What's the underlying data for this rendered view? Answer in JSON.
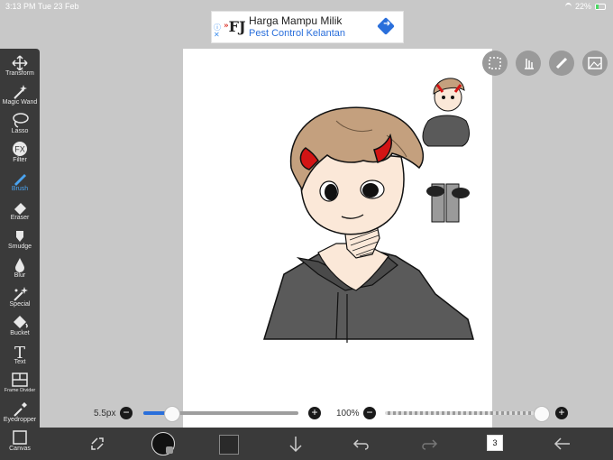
{
  "status_bar": {
    "time_date": "3:13 PM   Tue 23 Feb",
    "battery": "22%"
  },
  "ad": {
    "title": "Harga Mampu Milik",
    "subtitle": "Pest Control Kelantan",
    "logo": "FJ",
    "info_icon": "info-icon",
    "close_icon": "close-icon",
    "action_icon": "directions-icon"
  },
  "tools": [
    {
      "label": "Transform",
      "icon": "transform-icon"
    },
    {
      "label": "Magic Wand",
      "icon": "magic-wand-icon"
    },
    {
      "label": "Lasso",
      "icon": "lasso-icon"
    },
    {
      "label": "Filter",
      "icon": "fx-icon",
      "glyph": "FX"
    },
    {
      "label": "Brush",
      "icon": "brush-icon",
      "active": true
    },
    {
      "label": "Eraser",
      "icon": "eraser-icon"
    },
    {
      "label": "Smudge",
      "icon": "smudge-icon"
    },
    {
      "label": "Blur",
      "icon": "blur-icon"
    },
    {
      "label": "Special",
      "icon": "special-icon"
    },
    {
      "label": "Bucket",
      "icon": "bucket-icon"
    },
    {
      "label": "Text",
      "icon": "text-icon",
      "glyph": "T"
    },
    {
      "label": "Frame Divider",
      "icon": "frame-divider-icon"
    },
    {
      "label": "Eyedropper",
      "icon": "eyedropper-icon"
    },
    {
      "label": "Canvas",
      "icon": "canvas-icon"
    }
  ],
  "canvas_actions": [
    "selection-icon",
    "touch-icon",
    "ruler-pen-icon",
    "image-import-icon"
  ],
  "brush_size": {
    "value": "5.5px",
    "minus": "−",
    "plus": "+",
    "fraction": 0.18
  },
  "opacity": {
    "value": "100%",
    "minus": "−",
    "plus": "+",
    "fraction": 1.0
  },
  "bottom_bar": {
    "icons": [
      "transform-toggle-icon",
      "brush-settings-icon",
      "color-swatch",
      "download-icon",
      "undo-icon",
      "redo-icon",
      "layers-icon",
      "back-icon"
    ],
    "layers_count": "3",
    "color": "#2a2a2a"
  },
  "colors": {
    "toolbar_bg": "#3a3a3a",
    "accent": "#4aa3f0",
    "hair": "#c4a07e",
    "horn": "#d31414",
    "hoodie": "#5a5a5a",
    "skin": "#fbe8d8"
  }
}
